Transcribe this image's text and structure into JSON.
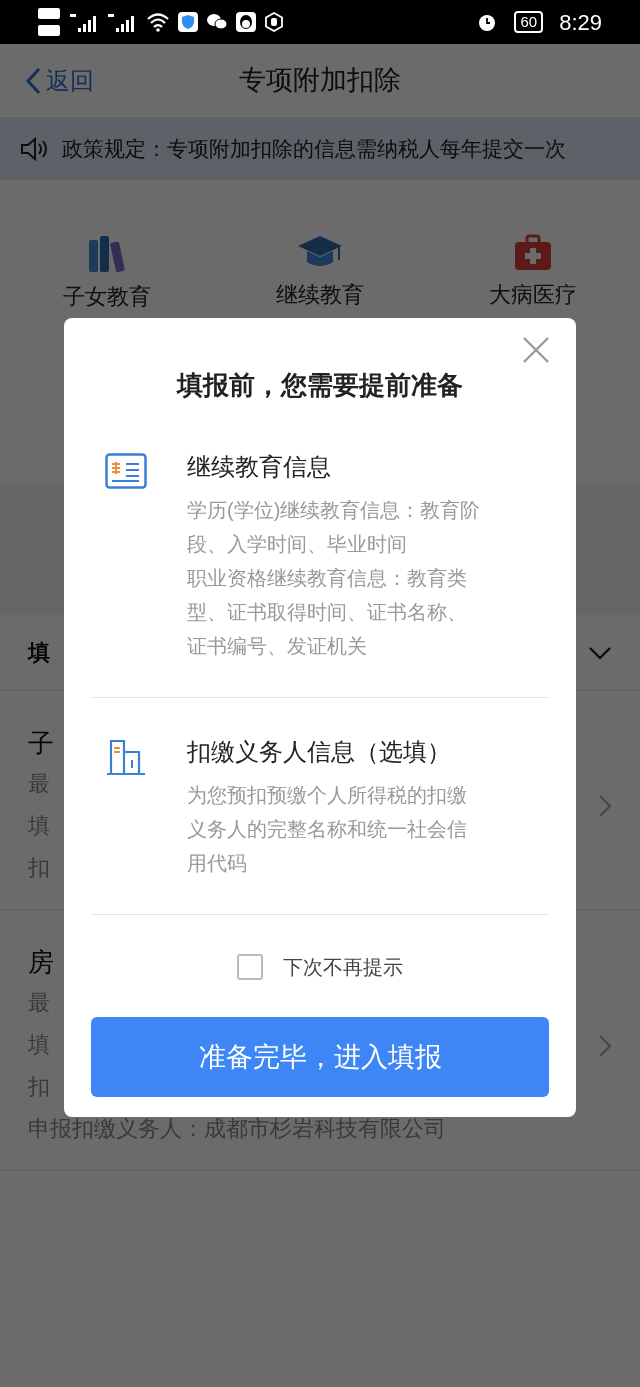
{
  "status_bar": {
    "battery": "60",
    "time": "8:29"
  },
  "nav": {
    "back": "返回",
    "title": "专项附加扣除"
  },
  "notice": "政策规定：专项附加扣除的信息需纳税人每年提交一次",
  "categories": [
    {
      "label": "子女教育",
      "kind": "books"
    },
    {
      "label": "继续教育",
      "kind": "cap"
    },
    {
      "label": "大病医疗",
      "kind": "medkit"
    }
  ],
  "section": {
    "title": "填"
  },
  "records": [
    {
      "lines": [
        "子",
        "最",
        "填",
        "扣"
      ]
    },
    {
      "lines": [
        "房",
        "最",
        "填",
        "扣",
        "申报扣缴义务人：成都市杉岩科技有限公司"
      ]
    }
  ],
  "modal": {
    "title": "填报前，您需要提前准备",
    "items": [
      {
        "kind": "education",
        "title": "继续教育信息",
        "description": [
          "学历(学位)继续教育信息：教育阶段、入学时间、毕业时间",
          "职业资格继续教育信息：教育类型、证书取得时间、证书名称、证书编号、发证机关"
        ]
      },
      {
        "kind": "withholder",
        "title": "扣缴义务人信息（选填）",
        "description": [
          "为您预扣预缴个人所得税的扣缴义务人的完整名称和统一社会信用代码"
        ]
      }
    ],
    "dont_show_again": {
      "label": "下次不再提示",
      "checked": false
    },
    "confirm": "准备完毕，进入填报"
  }
}
